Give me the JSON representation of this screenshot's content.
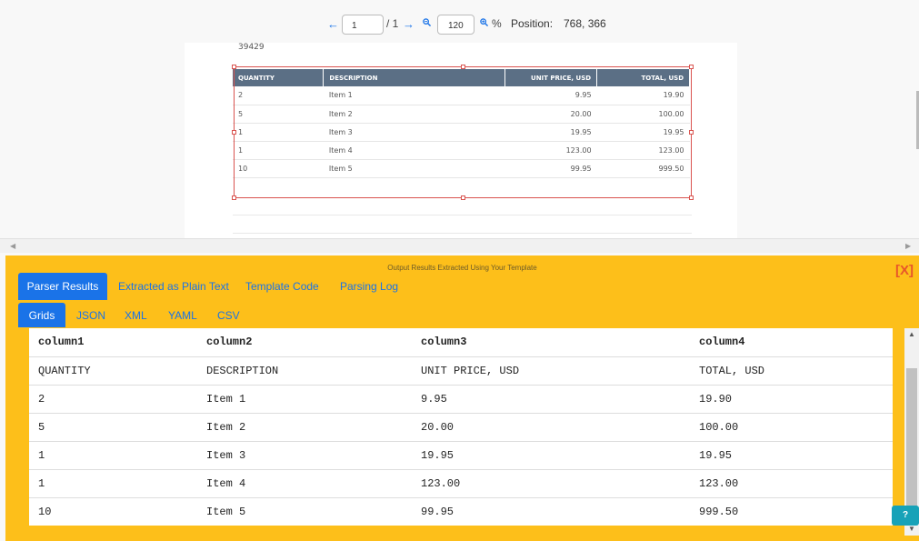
{
  "toolbar": {
    "prev_icon": "←",
    "page_value": "1",
    "page_of": "/ 1",
    "next_icon": "→",
    "zoom_out_icon": "🔍",
    "zoom_value": "120",
    "zoom_in_icon": "🔍",
    "percent": "%",
    "position_label": "Position:",
    "position_value": "768, 366"
  },
  "document": {
    "number": "39429",
    "headers": [
      "QUANTITY",
      "DESCRIPTION",
      "UNIT PRICE, USD",
      "TOTAL, USD"
    ],
    "rows": [
      [
        "2",
        "Item 1",
        "9.95",
        "19.90"
      ],
      [
        "5",
        "Item 2",
        "20.00",
        "100.00"
      ],
      [
        "1",
        "Item 3",
        "19.95",
        "19.95"
      ],
      [
        "1",
        "Item 4",
        "123.00",
        "123.00"
      ],
      [
        "10",
        "Item 5",
        "99.95",
        "999.50"
      ]
    ]
  },
  "scroll": {
    "left": "◀",
    "right": "▶",
    "up": "▲",
    "down": "▼"
  },
  "results": {
    "title": "Output Results Extracted Using Your Template",
    "close": "[X]",
    "tabs": [
      "Parser Results",
      "Extracted as Plain Text",
      "Template Code",
      "Parsing Log"
    ],
    "subtabs": [
      "Grids",
      "JSON",
      "XML",
      "YAML",
      "CSV"
    ],
    "grid_headers": [
      "column1",
      "column2",
      "column3",
      "column4"
    ],
    "grid_rows": [
      [
        "QUANTITY",
        "DESCRIPTION",
        "UNIT PRICE, USD",
        "TOTAL, USD"
      ],
      [
        "2",
        "Item 1",
        "9.95",
        "19.90"
      ],
      [
        "5",
        "Item 2",
        "20.00",
        "100.00"
      ],
      [
        "1",
        "Item 3",
        "19.95",
        "19.95"
      ],
      [
        "1",
        "Item 4",
        "123.00",
        "123.00"
      ],
      [
        "10",
        "Item 5",
        "99.95",
        "999.50"
      ]
    ],
    "help": "?"
  },
  "colors": {
    "accent": "#1a73e8",
    "panel": "#fdbf1a",
    "header": "#5b6f85",
    "selection": "#d9534f"
  }
}
